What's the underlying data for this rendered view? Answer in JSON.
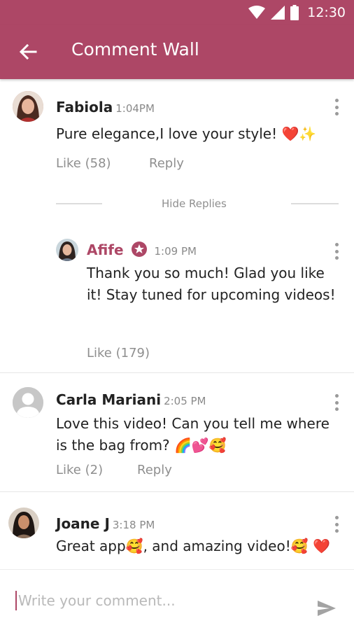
{
  "status_bar": {
    "time": "12:30"
  },
  "app_bar": {
    "title": "Comment Wall"
  },
  "comments": [
    {
      "author": "Fabiola",
      "time": "1:04PM",
      "text": "Pure elegance,I love your style! ❤️✨",
      "like_label": "Like (58)",
      "reply_label": "Reply"
    },
    {
      "author": "Carla Mariani",
      "time": "2:05 PM",
      "text": "Love this video! Can you tell me where is the bag from? 🌈💕🥰",
      "like_label": "Like (2)",
      "reply_label": "Reply"
    },
    {
      "author": "Joane J",
      "time": "3:18 PM",
      "text": "Great app🥰, and amazing video!🥰 ❤️"
    }
  ],
  "replies_toggle": "Hide Replies",
  "reply": {
    "author": "Afife",
    "time": "1:09 PM",
    "text": "Thank you so much! Glad you like it! Stay tuned for upcoming videos!",
    "like_label": "Like (179)"
  },
  "composer": {
    "placeholder": "Write your comment..."
  },
  "colors": {
    "brand": "#ad4766",
    "muted": "#8f8f8f"
  }
}
